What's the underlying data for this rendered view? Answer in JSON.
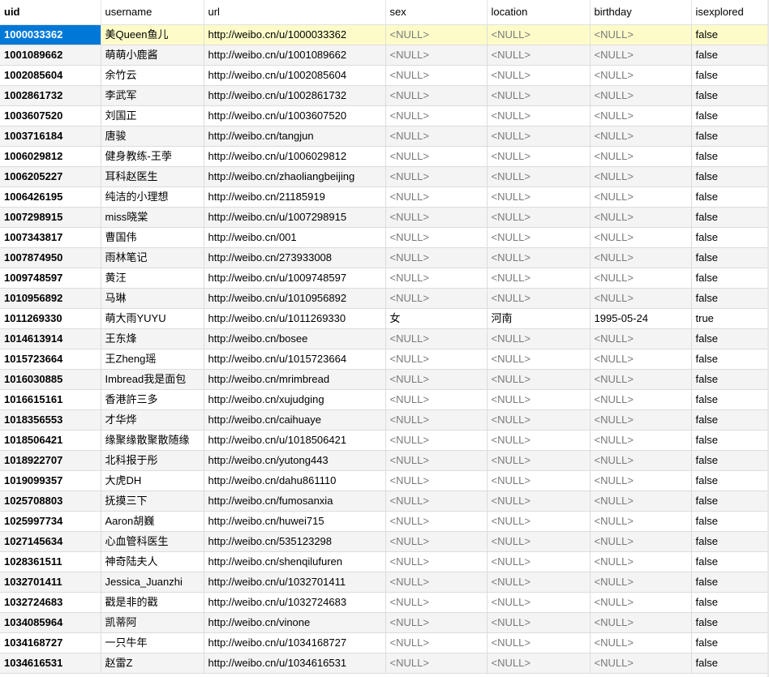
{
  "grid": {
    "columns": [
      "uid",
      "username",
      "url",
      "sex",
      "location",
      "birthday",
      "isexplored"
    ],
    "sort_indicator": "^",
    "selected_row": 0,
    "rows": [
      [
        "1000033362",
        "美Queen鱼儿",
        "http://weibo.cn/u/1000033362",
        "<NULL>",
        "<NULL>",
        "<NULL>",
        "false"
      ],
      [
        "1001089662",
        "萌萌小鹿酱",
        "http://weibo.cn/u/1001089662",
        "<NULL>",
        "<NULL>",
        "<NULL>",
        "false"
      ],
      [
        "1002085604",
        "余竹云",
        "http://weibo.cn/u/1002085604",
        "<NULL>",
        "<NULL>",
        "<NULL>",
        "false"
      ],
      [
        "1002861732",
        "李武军",
        "http://weibo.cn/u/1002861732",
        "<NULL>",
        "<NULL>",
        "<NULL>",
        "false"
      ],
      [
        "1003607520",
        "刘国正",
        "http://weibo.cn/u/1003607520",
        "<NULL>",
        "<NULL>",
        "<NULL>",
        "false"
      ],
      [
        "1003716184",
        "唐骏",
        "http://weibo.cn/tangjun",
        "<NULL>",
        "<NULL>",
        "<NULL>",
        "false"
      ],
      [
        "1006029812",
        "健身教练-王荸",
        "http://weibo.cn/u/1006029812",
        "<NULL>",
        "<NULL>",
        "<NULL>",
        "false"
      ],
      [
        "1006205227",
        "耳科赵医生",
        "http://weibo.cn/zhaoliangbeijing",
        "<NULL>",
        "<NULL>",
        "<NULL>",
        "false"
      ],
      [
        "1006426195",
        "纯洁的小理想",
        "http://weibo.cn/21185919",
        "<NULL>",
        "<NULL>",
        "<NULL>",
        "false"
      ],
      [
        "1007298915",
        "miss晓棠",
        "http://weibo.cn/u/1007298915",
        "<NULL>",
        "<NULL>",
        "<NULL>",
        "false"
      ],
      [
        "1007343817",
        "曹国伟",
        "http://weibo.cn/001",
        "<NULL>",
        "<NULL>",
        "<NULL>",
        "false"
      ],
      [
        "1007874950",
        "雨林笔记",
        "http://weibo.cn/273933008",
        "<NULL>",
        "<NULL>",
        "<NULL>",
        "false"
      ],
      [
        "1009748597",
        "黄汪",
        "http://weibo.cn/u/1009748597",
        "<NULL>",
        "<NULL>",
        "<NULL>",
        "false"
      ],
      [
        "1010956892",
        "马琳",
        "http://weibo.cn/u/1010956892",
        "<NULL>",
        "<NULL>",
        "<NULL>",
        "false"
      ],
      [
        "1011269330",
        "萌大雨YUYU",
        "http://weibo.cn/u/1011269330",
        "女",
        "河南",
        "1995-05-24",
        "true"
      ],
      [
        "1014613914",
        "王东烽",
        "http://weibo.cn/bosee",
        "<NULL>",
        "<NULL>",
        "<NULL>",
        "false"
      ],
      [
        "1015723664",
        "王Zheng瑶",
        "http://weibo.cn/u/1015723664",
        "<NULL>",
        "<NULL>",
        "<NULL>",
        "false"
      ],
      [
        "1016030885",
        "Imbread我是面包",
        "http://weibo.cn/mrimbread",
        "<NULL>",
        "<NULL>",
        "<NULL>",
        "false"
      ],
      [
        "1016615161",
        "香港許三多",
        "http://weibo.cn/xujudging",
        "<NULL>",
        "<NULL>",
        "<NULL>",
        "false"
      ],
      [
        "1018356553",
        "才华烨",
        "http://weibo.cn/caihuaye",
        "<NULL>",
        "<NULL>",
        "<NULL>",
        "false"
      ],
      [
        "1018506421",
        "缘聚缘散聚散随缘",
        "http://weibo.cn/u/1018506421",
        "<NULL>",
        "<NULL>",
        "<NULL>",
        "false"
      ],
      [
        "1018922707",
        "北科报于彤",
        "http://weibo.cn/yutong443",
        "<NULL>",
        "<NULL>",
        "<NULL>",
        "false"
      ],
      [
        "1019099357",
        "大虎DH",
        "http://weibo.cn/dahu861110",
        "<NULL>",
        "<NULL>",
        "<NULL>",
        "false"
      ],
      [
        "1025708803",
        "抚摸三下",
        "http://weibo.cn/fumosanxia",
        "<NULL>",
        "<NULL>",
        "<NULL>",
        "false"
      ],
      [
        "1025997734",
        "Aaron胡巍",
        "http://weibo.cn/huwei715",
        "<NULL>",
        "<NULL>",
        "<NULL>",
        "false"
      ],
      [
        "1027145634",
        "心血管科医生",
        "http://weibo.cn/535123298",
        "<NULL>",
        "<NULL>",
        "<NULL>",
        "false"
      ],
      [
        "1028361511",
        "神奇陆夫人",
        "http://weibo.cn/shenqilufuren",
        "<NULL>",
        "<NULL>",
        "<NULL>",
        "false"
      ],
      [
        "1032701411",
        "Jessica_Juanzhi",
        "http://weibo.cn/u/1032701411",
        "<NULL>",
        "<NULL>",
        "<NULL>",
        "false"
      ],
      [
        "1032724683",
        "戳是非的戳",
        "http://weibo.cn/u/1032724683",
        "<NULL>",
        "<NULL>",
        "<NULL>",
        "false"
      ],
      [
        "1034085964",
        "凯蒂阿",
        "http://weibo.cn/vinone",
        "<NULL>",
        "<NULL>",
        "<NULL>",
        "false"
      ],
      [
        "1034168727",
        "一只牛年",
        "http://weibo.cn/u/1034168727",
        "<NULL>",
        "<NULL>",
        "<NULL>",
        "false"
      ],
      [
        "1034616531",
        "赵雷Z",
        "http://weibo.cn/u/1034616531",
        "<NULL>",
        "<NULL>",
        "<NULL>",
        "false"
      ]
    ]
  }
}
